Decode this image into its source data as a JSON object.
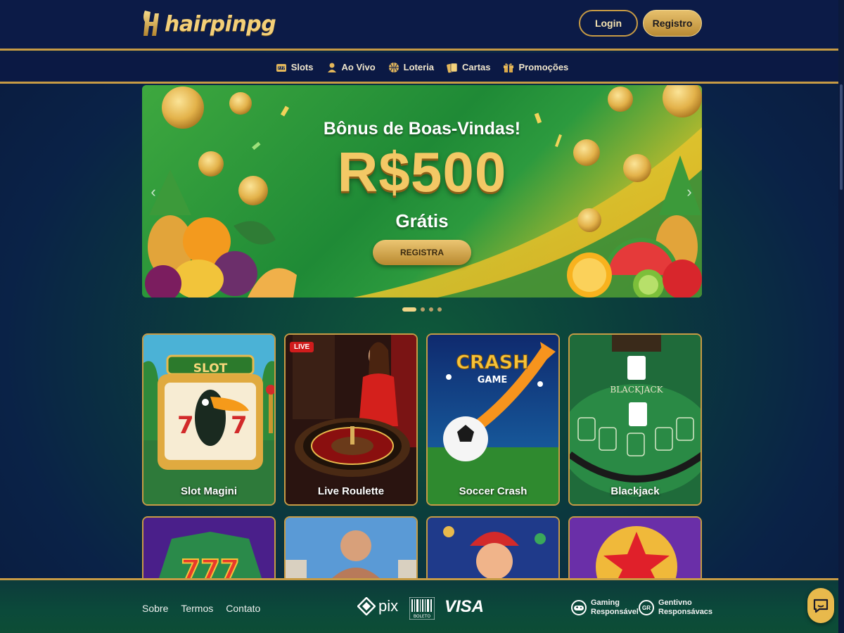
{
  "header": {
    "logo_text": "hairpinpg",
    "login_label": "Login",
    "register_label": "Registro"
  },
  "nav": {
    "items": [
      {
        "label": "Slots",
        "icon": "slot-machine-icon"
      },
      {
        "label": "Ao Vivo",
        "icon": "dealer-icon"
      },
      {
        "label": "Loteria",
        "icon": "lottery-ball-icon"
      },
      {
        "label": "Cartas",
        "icon": "cards-icon"
      },
      {
        "label": "Promoções",
        "icon": "gift-icon"
      }
    ]
  },
  "banner": {
    "title": "Bônus de Boas-Vindas!",
    "amount": "R$500",
    "subtitle": "Grátis",
    "cta_label": "REGISTRA",
    "slide_count": 4,
    "active_slide": 1
  },
  "games": {
    "row1": [
      {
        "label": "Slot Magini",
        "art_text": "SLOT"
      },
      {
        "label": "Live Roulette",
        "badge": "LIVE"
      },
      {
        "label": "Soccer Crash",
        "art_text": "CRASH",
        "art_subtext": "GAME"
      },
      {
        "label": "Blackjack",
        "art_text": "BLACKJACK"
      }
    ]
  },
  "footer": {
    "links": [
      "Sobre",
      "Termos",
      "Contato"
    ],
    "payments": {
      "pix": "pix",
      "boleto": "BOLETO",
      "visa": "VISA"
    },
    "responsible": [
      {
        "icon_text": "",
        "line1": "Gaming",
        "line2": "Responsável"
      },
      {
        "icon_text": "GR",
        "line1": "Gentivno",
        "line2": "Responsávacs"
      }
    ]
  },
  "colors": {
    "gold": "#c79b45",
    "navy": "#0c1b47",
    "banner_green": "#1f8a36"
  }
}
